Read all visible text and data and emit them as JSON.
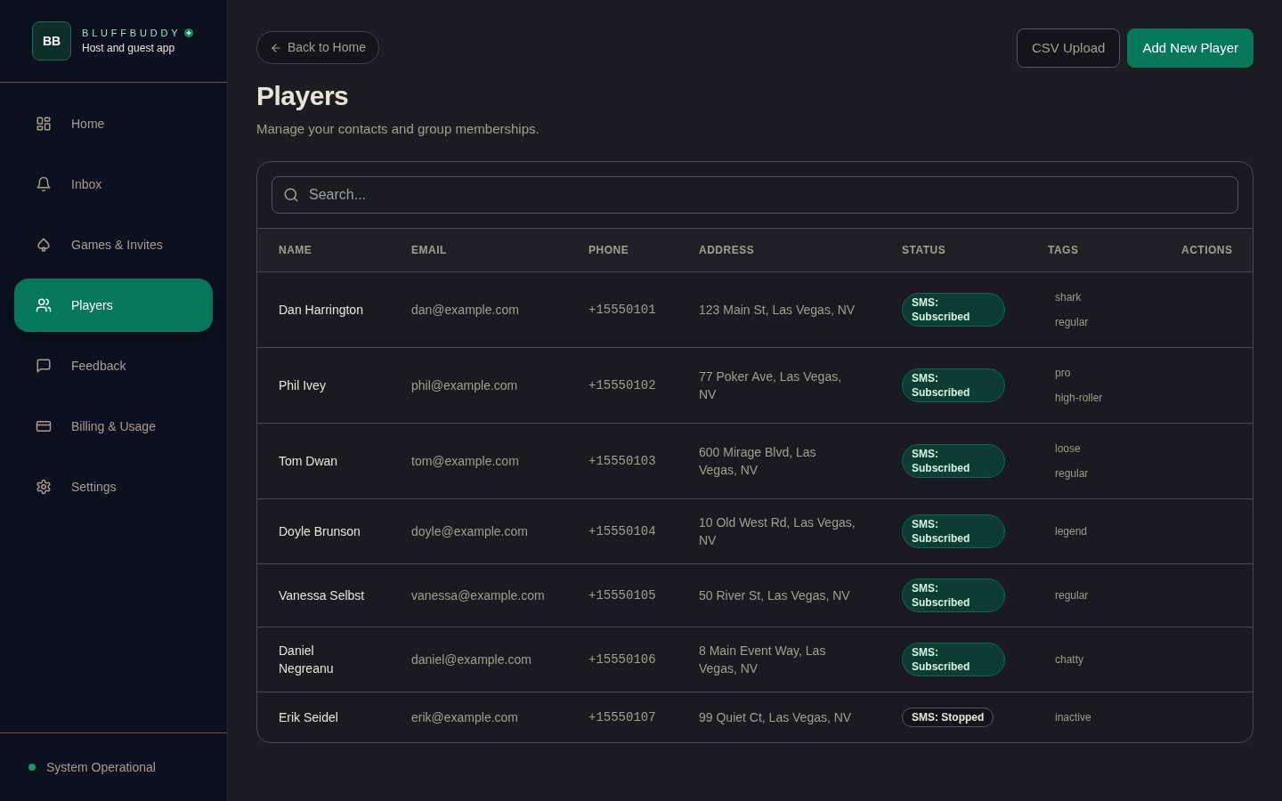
{
  "sidebar": {
    "brand": {
      "logo": "BB",
      "name": "BLUFFBUDDY",
      "tagline": "Host and guest app"
    },
    "items": [
      {
        "label": "Home",
        "selected": false
      },
      {
        "label": "Inbox",
        "selected": false
      },
      {
        "label": "Games & Invites",
        "selected": false
      },
      {
        "label": "Players",
        "selected": true
      },
      {
        "label": "Feedback",
        "selected": false
      },
      {
        "label": "Billing & Usage",
        "selected": false
      },
      {
        "label": "Settings",
        "selected": false
      }
    ],
    "status": "System Operational"
  },
  "header": {
    "back": "Back to Home",
    "buttons": [
      {
        "label": "CSV Upload",
        "kind": "outline"
      },
      {
        "label": "Add New Player",
        "kind": "primary"
      }
    ],
    "title": "Players",
    "subtitle": "Manage your contacts and group memberships."
  },
  "search": {
    "placeholder": "Search..."
  },
  "table": {
    "columns": [
      "NAME",
      "EMAIL",
      "PHONE",
      "ADDRESS",
      "STATUS",
      "TAGS",
      "ACTIONS"
    ],
    "rows": [
      {
        "name": "Dan Harrington",
        "email": "dan@example.com",
        "phone": "+15550101",
        "address": "123 Main St, Las Vegas, NV",
        "status": {
          "kind": "subscribed",
          "label": "SMS: Subscribed"
        },
        "tags": [
          "shark",
          "regular"
        ]
      },
      {
        "name": "Phil Ivey",
        "email": "phil@example.com",
        "phone": "+15550102",
        "address": "77 Poker Ave, Las Vegas, NV",
        "status": {
          "kind": "subscribed",
          "label": "SMS: Subscribed"
        },
        "tags": [
          "pro",
          "high-roller"
        ]
      },
      {
        "name": "Tom Dwan",
        "email": "tom@example.com",
        "phone": "+15550103",
        "address": "600 Mirage Blvd, Las Vegas, NV",
        "status": {
          "kind": "subscribed",
          "label": "SMS: Subscribed"
        },
        "tags": [
          "loose",
          "regular"
        ]
      },
      {
        "name": "Doyle Brunson",
        "email": "doyle@example.com",
        "phone": "+15550104",
        "address": "10 Old West Rd, Las Vegas, NV",
        "status": {
          "kind": "subscribed",
          "label": "SMS: Subscribed"
        },
        "tags": [
          "legend"
        ]
      },
      {
        "name": "Vanessa Selbst",
        "email": "vanessa@example.com",
        "phone": "+15550105",
        "address": "50 River St, Las Vegas, NV",
        "status": {
          "kind": "subscribed",
          "label": "SMS: Subscribed"
        },
        "tags": [
          "regular"
        ]
      },
      {
        "name": "Daniel Negreanu",
        "email": "daniel@example.com",
        "phone": "+15550106",
        "address": "8 Main Event Way, Las Vegas, NV",
        "status": {
          "kind": "subscribed",
          "label": "SMS: Subscribed"
        },
        "tags": [
          "chatty"
        ]
      },
      {
        "name": "Erik Seidel",
        "email": "erik@example.com",
        "phone": "+15550107",
        "address": "99 Quiet Ct, Las Vegas, NV",
        "status": {
          "kind": "stopped",
          "label": "SMS: Stopped"
        },
        "tags": [
          "inactive"
        ]
      }
    ]
  }
}
